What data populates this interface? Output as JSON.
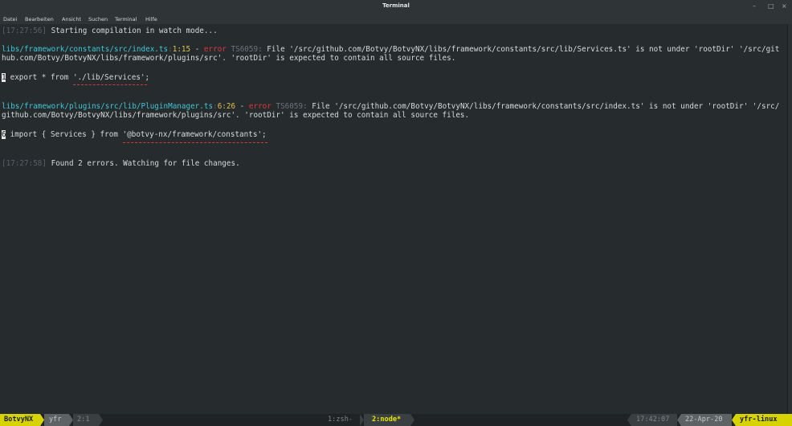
{
  "window": {
    "title": "Terminal",
    "minimize": "–",
    "maximize": "□",
    "close": "×"
  },
  "menu": [
    "Datei",
    "Bearbeiten",
    "Ansicht",
    "Suchen",
    "Terminal",
    "Hilfe"
  ],
  "terminal": {
    "line1": {
      "ts": "17:27:56",
      "text": " Starting compilation in watch mode..."
    },
    "err1": {
      "path": "libs/framework/constants/src/index.ts",
      "pos": "1:15",
      "sep": " - ",
      "label": "error",
      "code": " TS6059:",
      "msg_a": " File '/src/github.com/Botvy/BotvyNX/libs/framework/constants/src/lib/Services.ts' is not under 'rootDir' '/src/git",
      "msg_b": "hub.com/Botvy/BotvyNX/libs/framework/plugins/src'. 'rootDir' is expected to contain all source files.",
      "lineno": "1",
      "source": " export * from './lib/Services';"
    },
    "err2": {
      "path": "libs/framework/plugins/src/lib/PluginManager.ts",
      "pos": "6:26",
      "sep": " - ",
      "label": "error",
      "code": " TS6059:",
      "msg_a": " File '/src/github.com/Botvy/BotvyNX/libs/framework/constants/src/index.ts' is not under 'rootDir' '/src/",
      "msg_b": "github.com/Botvy/BotvyNX/libs/framework/plugins/src'. 'rootDir' is expected to contain all source files.",
      "lineno": "6",
      "source": " import { Services } from '@botvy-nx/framework/constants';"
    },
    "final": {
      "ts": "17:27:58",
      "text": " Found 2 errors. Watching for file changes."
    }
  },
  "tmux": {
    "session": "BotvyNX",
    "user": "yfr",
    "pane": "2:1",
    "win1": "1:zsh-",
    "win2": "2:node*",
    "time": "17:42:07",
    "date": "22-Apr-20",
    "host": "yfr-linux"
  },
  "colors": {
    "bg": "#262b2d",
    "path": "#40c6d6",
    "pos": "#e0c050",
    "error": "#e0363c",
    "tmux_accent": "#d6d300"
  }
}
